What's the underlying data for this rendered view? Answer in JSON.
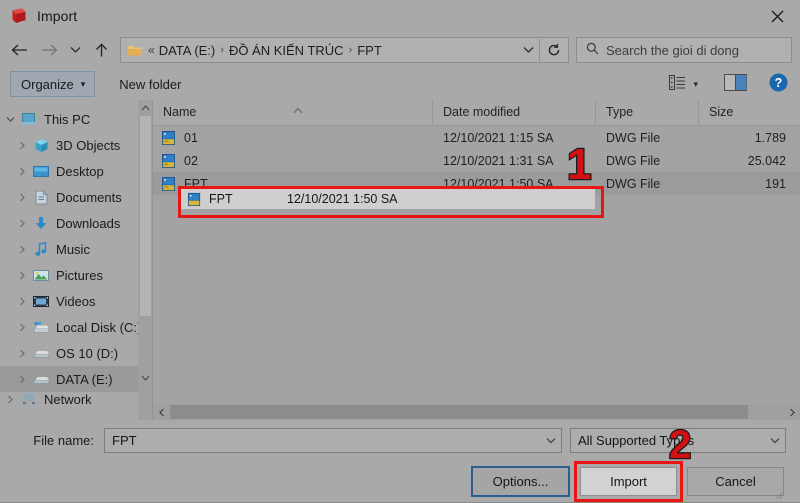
{
  "window": {
    "title": "Import",
    "title_icon": "sketchup-import-icon",
    "close_label": "✕"
  },
  "nav": {
    "back": "back-arrow",
    "forward": "forward-arrow",
    "recent": "recent-locations-chevron",
    "up": "up-arrow",
    "refresh": "↻",
    "breadcrumb_prefix": "«",
    "breadcrumbs": [
      "DATA (E:)",
      "ĐỒ ÁN KIẾN TRÚC",
      "FPT"
    ],
    "separator": "›"
  },
  "search": {
    "placeholder": "Search the gioi di dong",
    "icon": "search-icon"
  },
  "toolbar": {
    "organize_label": "Organize",
    "organize_caret": "▾",
    "new_folder_label": "New folder",
    "view_icon": "view-options-icon",
    "view_caret": "▾",
    "preview_pane_icon": "preview-pane-icon",
    "help_icon": "help-icon",
    "help_glyph": "?"
  },
  "sidebar": {
    "items": [
      {
        "label": "This PC",
        "icon": "this-pc-icon",
        "level": 1,
        "expanded": true,
        "selected": false
      },
      {
        "label": "3D Objects",
        "icon": "3d-objects-icon",
        "level": 2,
        "expanded": false,
        "selected": false
      },
      {
        "label": "Desktop",
        "icon": "desktop-icon",
        "level": 2,
        "expanded": false,
        "selected": false
      },
      {
        "label": "Documents",
        "icon": "documents-icon",
        "level": 2,
        "expanded": false,
        "selected": false
      },
      {
        "label": "Downloads",
        "icon": "downloads-icon",
        "level": 2,
        "expanded": false,
        "selected": false
      },
      {
        "label": "Music",
        "icon": "music-icon",
        "level": 2,
        "expanded": false,
        "selected": false
      },
      {
        "label": "Pictures",
        "icon": "pictures-icon",
        "level": 2,
        "expanded": false,
        "selected": false
      },
      {
        "label": "Videos",
        "icon": "videos-icon",
        "level": 2,
        "expanded": false,
        "selected": false
      },
      {
        "label": "Local Disk (C:)",
        "icon": "windows-drive-icon",
        "level": 2,
        "expanded": false,
        "selected": false
      },
      {
        "label": "OS 10 (D:)",
        "icon": "drive-icon",
        "level": 2,
        "expanded": false,
        "selected": false
      },
      {
        "label": "DATA (E:)",
        "icon": "drive-icon",
        "level": 2,
        "expanded": false,
        "selected": true
      },
      {
        "label": "Network",
        "icon": "network-icon",
        "level": 1,
        "expanded": false,
        "selected": false
      }
    ]
  },
  "filelist": {
    "columns": [
      "Name",
      "Date modified",
      "Type",
      "Size"
    ],
    "sort_column": "Name",
    "sort_direction": "asc",
    "rows": [
      {
        "name": "01",
        "date": "12/10/2021 1:15 SA",
        "type": "DWG File",
        "size": "1.789",
        "icon": "dwg-file-icon",
        "selected": false
      },
      {
        "name": "02",
        "date": "12/10/2021 1:31 SA",
        "type": "DWG File",
        "size": "25.042",
        "icon": "dwg-file-icon",
        "selected": false
      },
      {
        "name": "FPT",
        "date": "12/10/2021 1:50 SA",
        "type": "DWG File",
        "size": "191",
        "icon": "dwg-file-icon",
        "selected": true
      }
    ]
  },
  "footer": {
    "filename_label": "File name:",
    "filename_value": "FPT",
    "filetype_value": "All Supported Types",
    "options_button": "Options...",
    "import_button": "Import",
    "cancel_button": "Cancel"
  },
  "annotations": {
    "marker_one": "1",
    "marker_two": "2",
    "highlight_color": "#e81515"
  }
}
